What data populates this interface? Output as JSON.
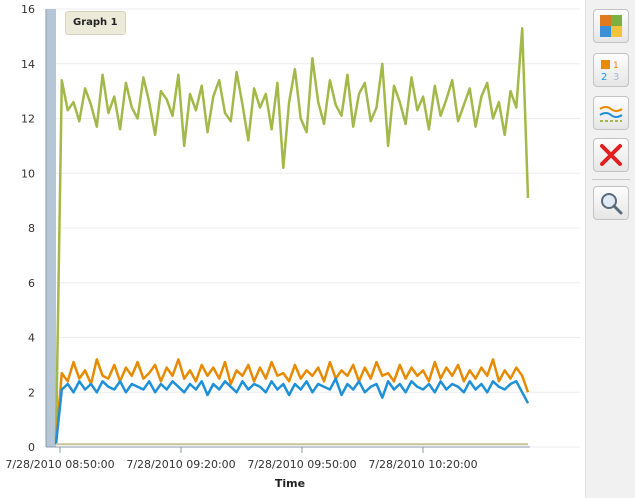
{
  "chart_data": {
    "type": "line",
    "legend": "Graph 1",
    "xlabel": "Time",
    "ylim": [
      0,
      16
    ],
    "yticks": [
      "0",
      "2",
      "4",
      "6",
      "8",
      "10",
      "12",
      "14",
      "16"
    ],
    "xticks": [
      "7/28/2010 08:50:00",
      "7/28/2010 09:20:00",
      "7/28/2010 09:50:00",
      "7/28/2010 10:20:00"
    ],
    "grid": true,
    "series": [
      {
        "color": "#a2b94a",
        "values": [
          0.2,
          13.4,
          12.3,
          12.6,
          11.9,
          13.1,
          12.5,
          11.7,
          13.6,
          12.2,
          12.8,
          11.6,
          13.3,
          12.4,
          12.0,
          13.5,
          12.6,
          11.4,
          13.0,
          12.7,
          12.1,
          13.6,
          11.0,
          12.9,
          12.3,
          13.2,
          11.5,
          12.8,
          13.4,
          12.2,
          11.9,
          13.7,
          12.5,
          11.2,
          13.1,
          12.4,
          12.9,
          11.6,
          13.3,
          10.2,
          12.6,
          13.8,
          12.0,
          11.5,
          14.2,
          12.6,
          11.8,
          13.4,
          12.5,
          12.1,
          13.6,
          11.7,
          12.9,
          13.3,
          11.9,
          12.4,
          14.0,
          11.0,
          13.2,
          12.6,
          11.8,
          13.5,
          12.3,
          12.8,
          11.6,
          13.2,
          12.1,
          12.7,
          13.4,
          11.9,
          12.5,
          13.1,
          11.7,
          12.8,
          13.3,
          12.0,
          12.6,
          11.4,
          13.0,
          12.4,
          15.3,
          9.1
        ]
      },
      {
        "color": "#e68a00",
        "values": [
          0.2,
          2.7,
          2.4,
          3.1,
          2.5,
          2.8,
          2.3,
          3.2,
          2.6,
          2.5,
          3.0,
          2.4,
          2.9,
          2.6,
          3.1,
          2.5,
          2.7,
          3.0,
          2.4,
          2.9,
          2.6,
          3.2,
          2.5,
          2.8,
          2.4,
          3.0,
          2.6,
          2.9,
          2.5,
          3.1,
          2.3,
          2.8,
          2.6,
          3.0,
          2.4,
          2.9,
          2.5,
          3.1,
          2.6,
          2.7,
          2.4,
          3.0,
          2.5,
          2.8,
          2.6,
          2.9,
          2.4,
          3.1,
          2.5,
          2.8,
          2.6,
          3.0,
          2.4,
          2.9,
          2.5,
          3.1,
          2.6,
          2.7,
          2.4,
          3.0,
          2.5,
          2.9,
          2.6,
          2.8,
          2.4,
          3.1,
          2.5,
          2.9,
          2.6,
          3.0,
          2.4,
          2.8,
          2.5,
          2.9,
          2.6,
          3.2,
          2.4,
          2.8,
          2.5,
          2.9,
          2.6,
          2.0
        ]
      },
      {
        "color": "#1e90d8",
        "values": [
          0.1,
          2.1,
          2.3,
          2.0,
          2.4,
          2.1,
          2.3,
          2.0,
          2.4,
          2.2,
          2.1,
          2.4,
          2.0,
          2.3,
          2.2,
          2.1,
          2.4,
          2.0,
          2.3,
          2.1,
          2.4,
          2.2,
          2.0,
          2.3,
          2.1,
          2.4,
          1.9,
          2.3,
          2.1,
          2.4,
          2.2,
          2.0,
          2.4,
          2.1,
          2.3,
          2.2,
          2.0,
          2.4,
          2.1,
          2.3,
          1.9,
          2.3,
          2.1,
          2.4,
          2.0,
          2.3,
          2.2,
          2.1,
          2.5,
          1.9,
          2.3,
          2.1,
          2.4,
          2.0,
          2.2,
          2.3,
          1.8,
          2.4,
          2.1,
          2.3,
          2.0,
          2.4,
          2.2,
          2.1,
          2.3,
          2.0,
          2.4,
          2.1,
          2.3,
          2.2,
          2.0,
          2.4,
          2.1,
          2.3,
          2.0,
          2.4,
          2.2,
          2.1,
          2.3,
          2.4,
          2.0,
          1.6
        ]
      },
      {
        "color": "#c7c39a",
        "values": [
          0.1,
          0.1,
          0.1,
          0.1,
          0.1,
          0.1,
          0.1,
          0.1,
          0.1,
          0.1,
          0.1,
          0.1,
          0.1,
          0.1,
          0.1,
          0.1,
          0.1,
          0.1,
          0.1,
          0.1,
          0.1,
          0.1,
          0.1,
          0.1,
          0.1,
          0.1,
          0.1,
          0.1,
          0.1,
          0.1,
          0.1,
          0.1,
          0.1,
          0.1,
          0.1,
          0.1,
          0.1,
          0.1,
          0.1,
          0.1,
          0.1,
          0.1,
          0.1,
          0.1,
          0.1,
          0.1,
          0.1,
          0.1,
          0.1,
          0.1,
          0.1,
          0.1,
          0.1,
          0.1,
          0.1,
          0.1,
          0.1,
          0.1,
          0.1,
          0.1,
          0.1,
          0.1,
          0.1,
          0.1,
          0.1,
          0.1,
          0.1,
          0.1,
          0.1,
          0.1,
          0.1,
          0.1,
          0.1,
          0.1,
          0.1,
          0.1,
          0.1,
          0.1,
          0.1,
          0.1,
          0.1,
          0.1
        ]
      }
    ]
  },
  "toolbar": {
    "buttons": [
      {
        "name": "color-palette-icon"
      },
      {
        "name": "numbered-legend-icon"
      },
      {
        "name": "line-style-icon"
      },
      {
        "name": "close-icon"
      },
      {
        "name": "zoom-icon"
      }
    ]
  }
}
